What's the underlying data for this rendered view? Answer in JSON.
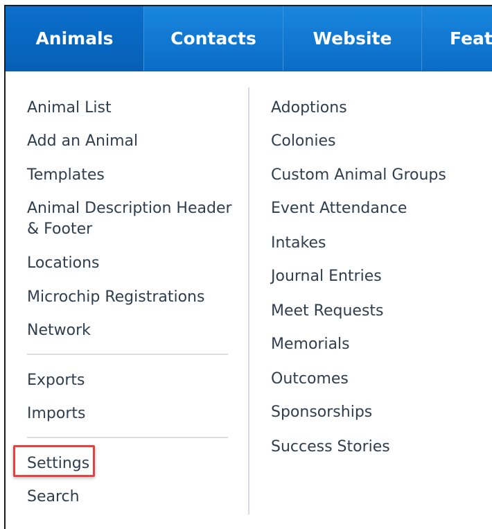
{
  "navbar": {
    "tabs": [
      {
        "label": "Animals"
      },
      {
        "label": "Contacts"
      },
      {
        "label": "Website"
      },
      {
        "label": "Feat"
      }
    ]
  },
  "menu": {
    "left_items": [
      {
        "label": "Animal List"
      },
      {
        "label": "Add an Animal"
      },
      {
        "label": "Templates"
      },
      {
        "label": "Animal Description Header & Footer"
      },
      {
        "label": "Locations"
      },
      {
        "label": "Microchip Registrations"
      },
      {
        "label": "Network"
      },
      {
        "label": "Exports"
      },
      {
        "label": "Imports"
      },
      {
        "label": "Settings"
      },
      {
        "label": "Search"
      }
    ],
    "right_items": [
      {
        "label": "Adoptions"
      },
      {
        "label": "Colonies"
      },
      {
        "label": "Custom Animal Groups"
      },
      {
        "label": "Event Attendance"
      },
      {
        "label": "Intakes"
      },
      {
        "label": "Journal Entries"
      },
      {
        "label": "Meet Requests"
      },
      {
        "label": "Memorials"
      },
      {
        "label": "Outcomes"
      },
      {
        "label": "Sponsorships"
      },
      {
        "label": "Success Stories"
      }
    ]
  },
  "colors": {
    "navbar": "#0a6cc6",
    "menu_text": "#2f3e4e",
    "highlight": "#e8403f"
  }
}
